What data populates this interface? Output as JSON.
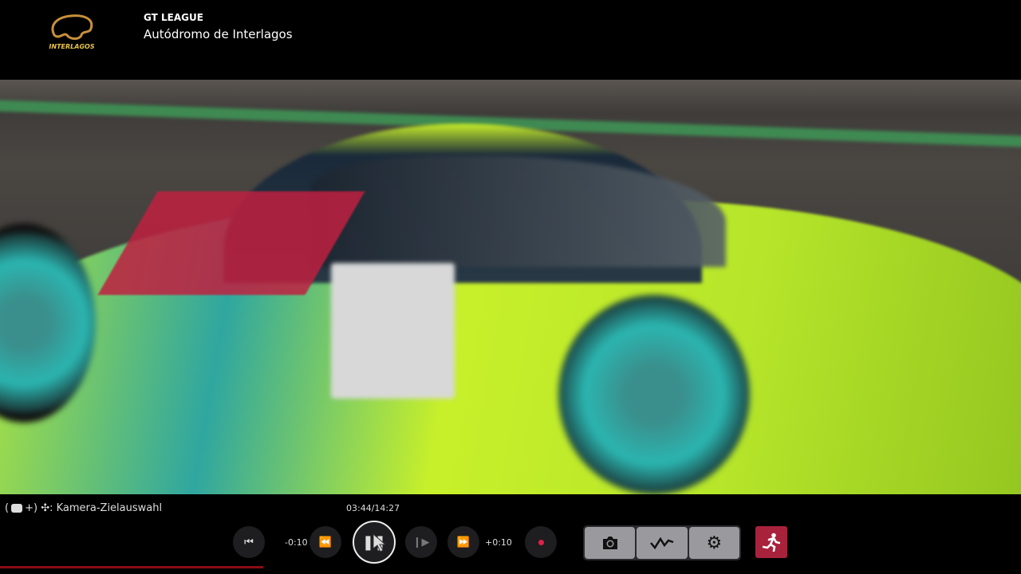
{
  "header": {
    "logo_text": "INTERLAGOS",
    "league": "GT LEAGUE",
    "track": "Autódromo de Interlagos"
  },
  "hud": {
    "hint": {
      "open": "(",
      "plus": "+)",
      "label": ": Kamera-Zielauswahl"
    },
    "time": "03:44/14:27",
    "progress_fraction": 0.258,
    "back_label": "-0:10",
    "forward_label": "+0:10",
    "icons": [
      "skip-to-start-icon",
      "rewind-icon",
      "pause-icon",
      "slow-motion-icon",
      "fast-forward-icon",
      "record-icon",
      "camera-icon",
      "telemetry-icon",
      "gear-icon",
      "exit-icon"
    ],
    "colors": {
      "record": "#e0204a",
      "exit": "#a8223c",
      "progress": "#8a0c14"
    }
  }
}
